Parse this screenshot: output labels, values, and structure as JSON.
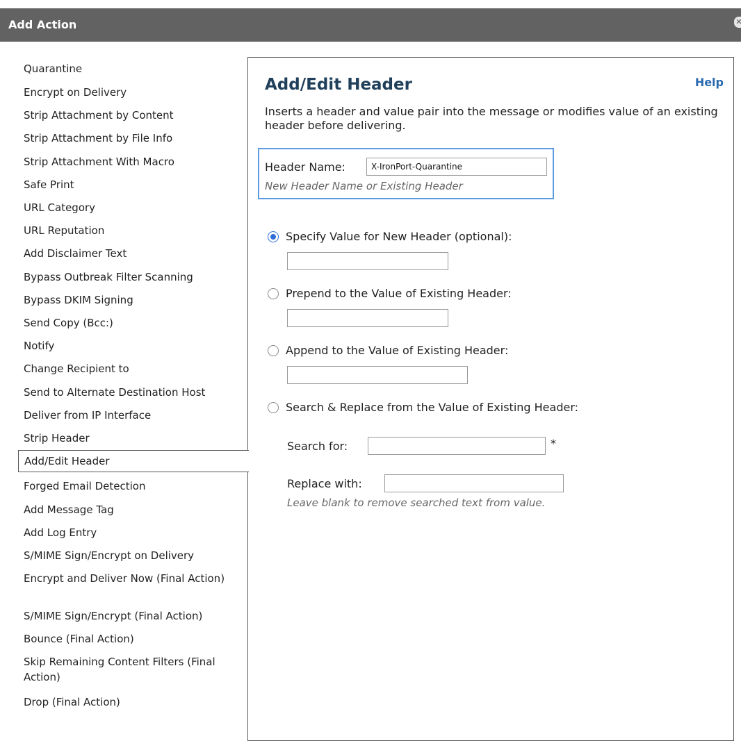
{
  "window": {
    "title": "Add Action"
  },
  "menu": {
    "items": [
      {
        "label": "Quarantine"
      },
      {
        "label": "Encrypt on Delivery"
      },
      {
        "label": "Strip Attachment by Content"
      },
      {
        "label": "Strip Attachment by File Info"
      },
      {
        "label": "Strip Attachment With Macro"
      },
      {
        "label": "Safe Print"
      },
      {
        "label": "URL Category"
      },
      {
        "label": "URL Reputation"
      },
      {
        "label": "Add Disclaimer Text"
      },
      {
        "label": "Bypass Outbreak Filter Scanning"
      },
      {
        "label": "Bypass DKIM Signing"
      },
      {
        "label": "Send Copy (Bcc:)"
      },
      {
        "label": "Notify"
      },
      {
        "label": "Change Recipient to"
      },
      {
        "label": "Send to Alternate Destination Host"
      },
      {
        "label": "Deliver from IP Interface"
      },
      {
        "label": "Strip Header"
      },
      {
        "label": "Add/Edit Header",
        "selected": true
      },
      {
        "label": "Forged Email Detection"
      },
      {
        "label": "Add Message Tag"
      },
      {
        "label": "Add Log Entry"
      },
      {
        "label": "S/MIME Sign/Encrypt on Delivery"
      },
      {
        "label": "Encrypt and Deliver Now (Final Action)"
      },
      {
        "label": "S/MIME Sign/Encrypt (Final Action)"
      },
      {
        "label": "Bounce (Final Action)"
      },
      {
        "label": "Skip Remaining Content Filters (Final Action)"
      },
      {
        "label": "Drop (Final Action)"
      }
    ]
  },
  "panel": {
    "title": "Add/Edit Header",
    "help": "Help",
    "description": "Inserts a header and value pair into the message or modifies value of an existing header before delivering.",
    "header_name": {
      "label": "Header Name:",
      "value": "X-IronPort-Quarantine",
      "hint": "New Header Name or Existing Header"
    },
    "options": [
      {
        "label": "Specify Value for New Header (optional):",
        "checked": true,
        "value": ""
      },
      {
        "label": "Prepend to the Value of Existing Header:",
        "checked": false,
        "value": ""
      },
      {
        "label": "Append to the Value of Existing Header:",
        "checked": false,
        "value": ""
      },
      {
        "label": "Search & Replace from the Value of Existing Header:",
        "checked": false
      }
    ],
    "search": {
      "label": "Search for:",
      "value": "",
      "required_mark": "*"
    },
    "replace": {
      "label": "Replace with:",
      "value": "",
      "hint": "Leave blank to remove searched text from value."
    }
  },
  "colors": {
    "titlebar": "#626262",
    "panel_title": "#1f3f5a",
    "help_link": "#2a6ab0",
    "focus_border": "#5b9be0",
    "radio_checked": "#2f6fd6"
  }
}
